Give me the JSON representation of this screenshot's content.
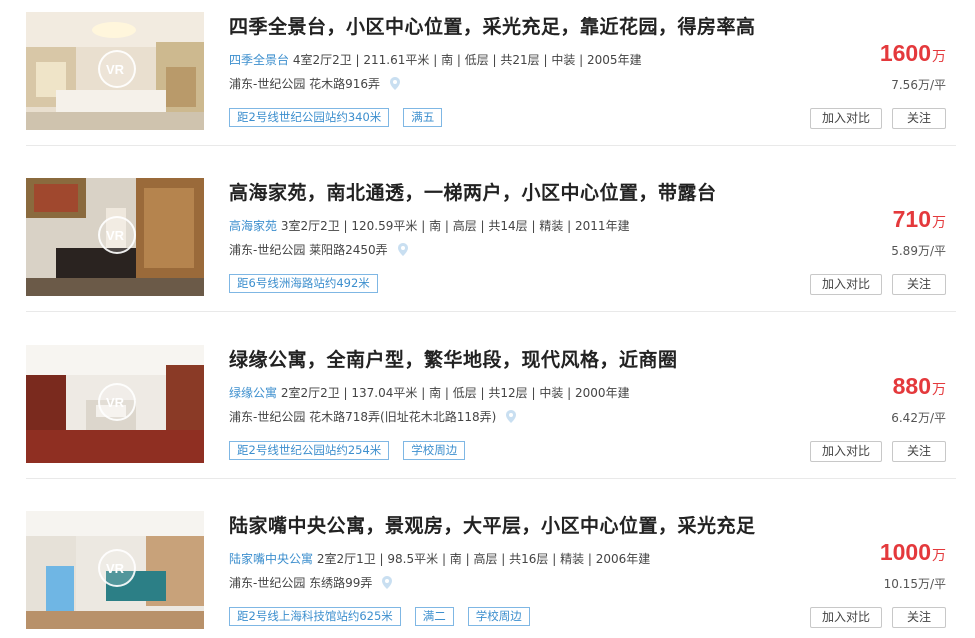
{
  "listings": [
    {
      "title": "四季全景台，小区中心位置，采光充足，靠近花园，得房率高",
      "community": "四季全景台",
      "details": " 4室2厅2卫 | 211.61平米 | 南 | 低层 | 共21层 | 中装 | 2005年建",
      "address": "浦东-世纪公园 花木路916弄",
      "tags": [
        "距2号线世纪公园站约340米",
        "满五"
      ],
      "price": "1600",
      "price_unit": "万",
      "unit_price": "7.56万/平",
      "compare_label": "加入对比",
      "follow_label": "关注"
    },
    {
      "title": "高海家苑，南北通透，一梯两户，小区中心位置，带露台",
      "community": "高海家苑",
      "details": " 3室2厅2卫 | 120.59平米 | 南 | 高层 | 共14层 | 精装 | 2011年建",
      "address": "浦东-世纪公园 莱阳路2450弄",
      "tags": [
        "距6号线洲海路站约492米"
      ],
      "price": "710",
      "price_unit": "万",
      "unit_price": "5.89万/平",
      "compare_label": "加入对比",
      "follow_label": "关注"
    },
    {
      "title": "绿缘公寓，全南户型，繁华地段，现代风格，近商圈",
      "community": "绿缘公寓",
      "details": " 2室2厅2卫 | 137.04平米 | 南 | 低层 | 共12层 | 中装 | 2000年建",
      "address": "浦东-世纪公园 花木路718弄(旧址花木北路118弄)",
      "tags": [
        "距2号线世纪公园站约254米",
        "学校周边"
      ],
      "price": "880",
      "price_unit": "万",
      "unit_price": "6.42万/平",
      "compare_label": "加入对比",
      "follow_label": "关注"
    },
    {
      "title": "陆家嘴中央公寓，景观房，大平层，小区中心位置，采光充足",
      "community": "陆家嘴中央公寓",
      "details": " 2室2厅1卫 | 98.5平米 | 南 | 高层 | 共16层 | 精装 | 2006年建",
      "address": "浦东-世纪公园 东绣路99弄",
      "tags": [
        "距2号线上海科技馆站约625米",
        "满二",
        "学校周边"
      ],
      "price": "1000",
      "price_unit": "万",
      "unit_price": "10.15万/平",
      "compare_label": "加入对比",
      "follow_label": "关注"
    }
  ],
  "icons": {
    "vr": "vr-badge-icon",
    "location": "map-pin-icon"
  },
  "colors": {
    "price": "#e4393c",
    "link": "#3d8fce",
    "tag_border": "#7fb7e4"
  }
}
